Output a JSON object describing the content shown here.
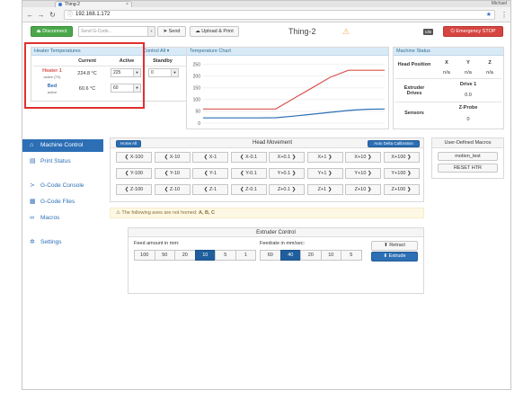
{
  "browser": {
    "tab_title": "Thing-2",
    "user": "Michael",
    "url": "192.168.1.172"
  },
  "topbar": {
    "disconnect_label": "Disconnect",
    "gcode_placeholder": "Send G-Code...",
    "send_label": "Send",
    "upload_label": "Upload & Print",
    "machine_name": "Thing-2",
    "status_badge": "Idle",
    "emergency_label": "Emergency STOP"
  },
  "heater": {
    "title": "Heater Temperatures",
    "control_all": "Control All",
    "headers": [
      "",
      "Current",
      "Active",
      "Standby"
    ],
    "rows": [
      {
        "name": "Heater 1",
        "state": "active (T0)",
        "current": "224.8 °C",
        "active": "225",
        "standby": "0",
        "color": "#d9534f"
      },
      {
        "name": "Bed",
        "state": "active",
        "current": "60.6 °C",
        "active": "60",
        "standby": "",
        "color": "#2c6fb5"
      }
    ]
  },
  "temp_chart": {
    "title": "Temperature Chart"
  },
  "chart_data": {
    "type": "line",
    "title": "Temperature Chart",
    "xlabel": "",
    "ylabel": "",
    "ylim": [
      0,
      260
    ],
    "yticks": [
      0,
      50,
      100,
      150,
      200,
      250
    ],
    "x": [
      0,
      10,
      20,
      30,
      40,
      50,
      60,
      70,
      80,
      90,
      100
    ],
    "series": [
      {
        "values": [
          60,
          60,
          60,
          60,
          60,
          105,
          150,
          195,
          225,
          225,
          225
        ],
        "color": "#d9534f"
      },
      {
        "values": [
          22,
          22,
          22,
          22,
          23,
          30,
          38,
          46,
          54,
          59,
          60
        ],
        "color": "#2c6fb5"
      }
    ],
    "grid": true
  },
  "machine_status": {
    "title": "Machine Status",
    "head_position_label": "Head Position",
    "axes": [
      "X",
      "Y",
      "Z"
    ],
    "axis_values": [
      "n/a",
      "n/a",
      "n/a"
    ],
    "extruder_drives_label": "Extruder Drives",
    "drive_name": "Drive 1",
    "drive_value": "0.0",
    "sensors_label": "Sensors",
    "sensor_name": "Z-Probe",
    "sensor_value": "0"
  },
  "sidebar": {
    "items": [
      {
        "label": "Machine Control",
        "icon": "home-icon",
        "glyph": "⌂",
        "active": true
      },
      {
        "label": "Print Status",
        "icon": "print-status-icon",
        "glyph": "▤",
        "active": false
      },
      {
        "label": "G-Code Console",
        "icon": "console-icon",
        "glyph": "≻",
        "active": false
      },
      {
        "label": "G-Code Files",
        "icon": "files-icon",
        "glyph": "▦",
        "active": false
      },
      {
        "label": "Macros",
        "icon": "link-icon",
        "glyph": "∞",
        "active": false
      },
      {
        "label": "Settings",
        "icon": "gear-icon",
        "glyph": "✲",
        "active": false
      }
    ]
  },
  "head_movement": {
    "home_all": "Home All",
    "title": "Head Movement",
    "auto_delta": "Auto Delta Calibration",
    "rows": [
      [
        "X-100",
        "X-10",
        "X-1",
        "X-0.1",
        "X+0.1",
        "X+1",
        "X+10",
        "X+100"
      ],
      [
        "Y-100",
        "Y-10",
        "Y-1",
        "Y-0.1",
        "Y+0.1",
        "Y+1",
        "Y+10",
        "Y+100"
      ],
      [
        "Z-100",
        "Z-10",
        "Z-1",
        "Z-0.1",
        "Z+0.1",
        "Z+1",
        "Z+10",
        "Z+100"
      ]
    ],
    "warning_text": "The following axes are not homed: ",
    "warning_axes": "A, B, C"
  },
  "macros": {
    "title": "User-Defined Macros",
    "items": [
      "motion_test",
      "RESET HTR"
    ]
  },
  "extruder": {
    "title": "Extruder Control",
    "feed_label": "Feed amount in mm:",
    "feed_options": [
      "100",
      "50",
      "20",
      "10",
      "5",
      "1"
    ],
    "feed_selected": "10",
    "rate_label": "Feedrate in mm/sec:",
    "rate_options": [
      "60",
      "40",
      "20",
      "10",
      "5"
    ],
    "rate_selected": "40",
    "retract_label": "Retract",
    "extrude_label": "Extrude"
  },
  "colors": {
    "accent": "#2c6fb5",
    "highlight_border": "#e0302f",
    "danger": "#d64541",
    "success": "#4aa84a"
  }
}
